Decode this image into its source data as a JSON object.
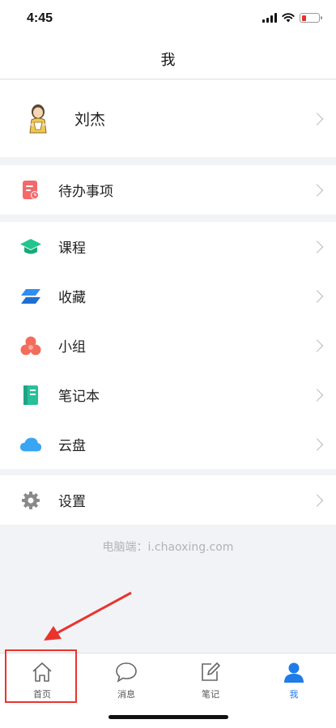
{
  "status_bar": {
    "time": "4:45"
  },
  "header": {
    "title": "我"
  },
  "profile": {
    "name": "刘杰"
  },
  "todo": {
    "label": "待办事项"
  },
  "menu": {
    "items": [
      {
        "label": "课程",
        "icon": "graduation-cap-icon",
        "color": "#23c48e"
      },
      {
        "label": "收藏",
        "icon": "layers-icon",
        "color": "#2d8ff0"
      },
      {
        "label": "小组",
        "icon": "group-circles-icon",
        "color": "#f36d5c"
      },
      {
        "label": "笔记本",
        "icon": "notebook-icon",
        "color": "#27c09b"
      },
      {
        "label": "云盘",
        "icon": "cloud-icon",
        "color": "#3aa5f2"
      }
    ]
  },
  "settings": {
    "label": "设置"
  },
  "footer": {
    "text": "电脑端：i.chaoxing.com"
  },
  "tabbar": {
    "tabs": [
      {
        "label": "首页",
        "icon": "home-icon",
        "active": false
      },
      {
        "label": "消息",
        "icon": "chat-bubble-icon",
        "active": false
      },
      {
        "label": "笔记",
        "icon": "edit-note-icon",
        "active": false
      },
      {
        "label": "我",
        "icon": "person-icon",
        "active": true
      }
    ]
  },
  "colors": {
    "accent": "#1f7be8",
    "annotation": "#e8342c",
    "battery_low": "#e5322d"
  }
}
